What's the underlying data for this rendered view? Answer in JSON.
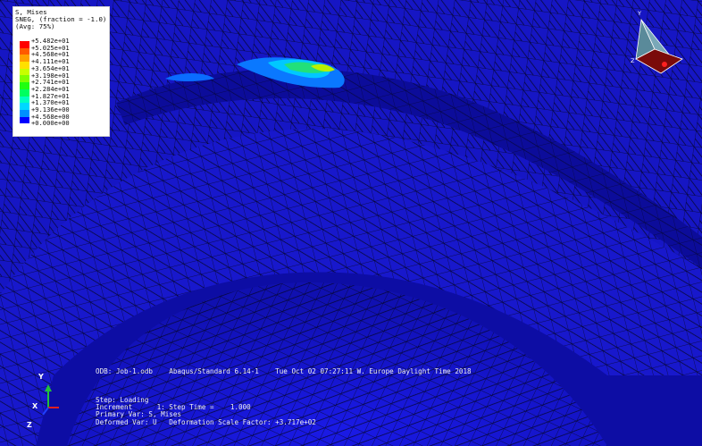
{
  "legend": {
    "title": "S, Mises",
    "subtitle": "SNEG, (fraction = -1.0)",
    "average": "(Avg: 75%)",
    "entries": [
      {
        "value": "+5.482e+01",
        "color": "#ff0000"
      },
      {
        "value": "+5.025e+01",
        "color": "#ff5a00"
      },
      {
        "value": "+4.568e+01",
        "color": "#ffa000"
      },
      {
        "value": "+4.111e+01",
        "color": "#ffe000"
      },
      {
        "value": "+3.654e+01",
        "color": "#c8ff00"
      },
      {
        "value": "+3.198e+01",
        "color": "#80ff00"
      },
      {
        "value": "+2.741e+01",
        "color": "#20ff10"
      },
      {
        "value": "+2.284e+01",
        "color": "#00ff60"
      },
      {
        "value": "+1.827e+01",
        "color": "#00ffc0"
      },
      {
        "value": "+1.370e+01",
        "color": "#00d8ff"
      },
      {
        "value": "+9.136e+00",
        "color": "#0090ff"
      },
      {
        "value": "+4.568e+00",
        "color": "#0040ff"
      },
      {
        "value": "+0.000e+00",
        "color": null
      }
    ],
    "bottom_color": "#0000ff"
  },
  "info": {
    "odb_line": "ODB: Job-1.odb    Abaqus/Standard 6.14-1    Tue Oct 02 07:27:11 W. Europe Daylight Time 2018",
    "step": "Step: Loading",
    "increment": "Increment      1: Step Time =    1.000",
    "primary_var": "Primary Var: S, Mises",
    "deformed_var": "Deformed Var: U   Deformation Scale Factor: +3.717e+02"
  },
  "triad": {
    "x": "X",
    "y": "Y",
    "z": "Z"
  },
  "view_cube": {
    "y": "Y",
    "z": "Z"
  },
  "colors": {
    "mesh_base": "#1414c8",
    "mesh_line": "#00001e",
    "background": "#0a0a8c"
  }
}
